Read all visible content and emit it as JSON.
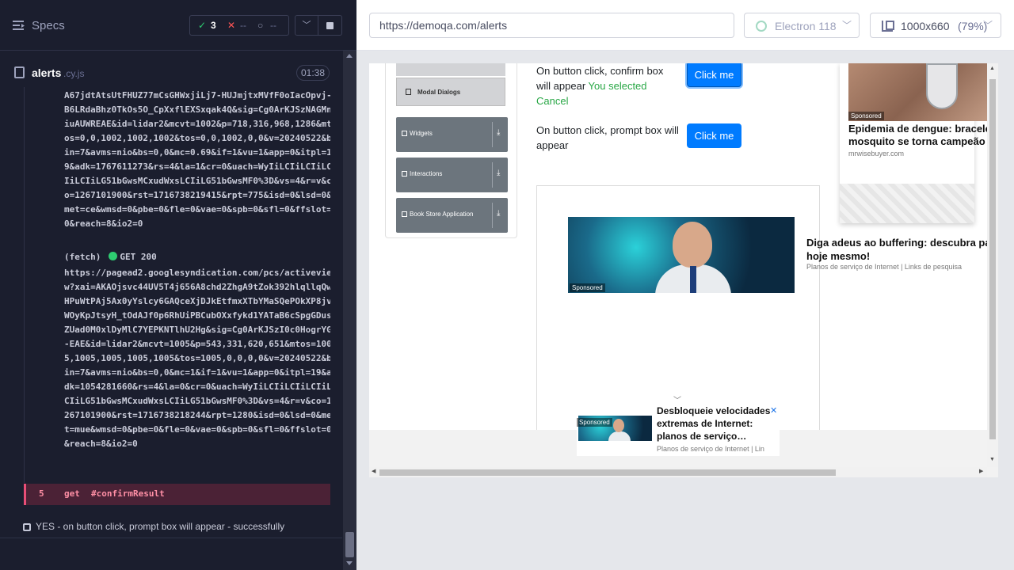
{
  "reporter": {
    "header": {
      "specs_label": "Specs",
      "passed_count": "3",
      "failed_count": "--",
      "pending_count": "--",
      "pass_icon": "✓",
      "fail_icon": "✕",
      "pending_icon": "○"
    },
    "file": {
      "name": "alerts",
      "ext": ".cy.js",
      "duration": "01:38"
    },
    "log_block_1": "A67jdtAtsUtFHUZ77mCsGHWxjiLj7-HUJmjtxMVfF0oIacOpvj-B6LRdaBhz0TkOs5O_CpXxflEXSxqak4Q&sig=Cg0ArKJSzNAGMniuAUWREAE&id=lidar2&mcvt=1002&p=718,316,968,1286&mtos=0,0,1002,1002,1002&tos=0,0,1002,0,0&v=20240522&bin=7&avms=nio&bs=0,0&mc=0.69&if=1&vu=1&app=0&itpl=19&adk=1767611273&rs=4&la=1&cr=0&uach=WyIiLCIiLCIiLCIiLCIiLG51bGwsMCxudWxsLCIiLG51bGwsMF0%3D&vs=4&r=v&co=1267101900&rst=1716738219415&rpt=775&isd=0&lsd=0&met=ce&wmsd=0&pbe=0&fle=0&vae=0&spb=0&sfl=0&ffslot=0&reach=8&io2=0",
    "fetch_label": "(fetch)",
    "fetch_status": "GET 200",
    "log_block_2": "https://pagead2.googlesyndication.com/pcs/activeview?xai=AKAOjsvc44UV5T4j656A8chd2ZhgA9tZok392hlqllqQwHPuWtPAj5Ax0yYslcy6GAQceXjDJkEtfmxXTbYMaSQePOkXP8jvWOyKpJtsyH_tOdAJf0p6RhUiPBCubOXxfykd1YATaB6cSpgGDusZUad0M0xlDyMlC7YEPKNTlhU2Hg&sig=Cg0ArKJSzI0c0HogrYG-EAE&id=lidar2&mcvt=1005&p=543,331,620,651&mtos=1005,1005,1005,1005,1005&tos=1005,0,0,0,0&v=20240522&bin=7&avms=nio&bs=0,0&mc=1&if=1&vu=1&app=0&itpl=19&adk=1054281660&rs=4&la=0&cr=0&uach=WyIiLCIiLCIiLCIiLCIiLG51bGwsMCxudWxsLCIiLG51bGwsMF0%3D&vs=4&r=v&co=1267101900&rst=1716738218244&rpt=1280&isd=0&lsd=0&met=mue&wmsd=0&pbe=0&fle=0&vae=0&spb=0&sfl=0&ffslot=0&reach=8&io2=0",
    "command": {
      "number": "5",
      "name": "get",
      "arg": "#confirmResult"
    },
    "test_2_label": "YES - on button click, prompt box will appear - successfully"
  },
  "aut": {
    "url": "https://demoqa.com/alerts",
    "browser": "Electron 118",
    "viewport": "1000x660",
    "zoom": "(79%)"
  },
  "site": {
    "menu": {
      "modal_dialogs": "Modal Dialogs",
      "widgets": "Widgets",
      "interactions": "Interactions",
      "book_store": "Book Store Application"
    },
    "confirm_text": "On button click, confirm box will appear",
    "confirm_result": "You selected Cancel",
    "prompt_text": "On button click, prompt box will appear",
    "click_me": "Click me"
  },
  "ads": {
    "sponsored": "Sponsored",
    "ad1_headline": "Diga adeus ao buffering: descubra pa hoje mesmo!",
    "ad1_source": "Planos de serviço de Internet | Links de pesquisa",
    "ad2_headline": "Epidemia de dengue: bracele mosquito se torna campeão d",
    "ad2_source": "mrwisebuyer.com",
    "bb_headline": "Desbloqueie velocidades extremas de Internet: planos de serviço…",
    "bb_source": "Planos de serviço de Internet | Lin"
  }
}
